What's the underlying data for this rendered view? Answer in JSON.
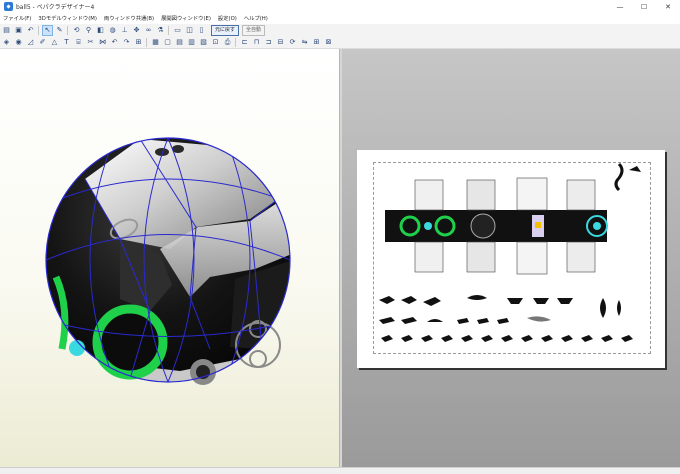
{
  "window": {
    "title": "ball5 - ペパクラデザイナー4",
    "controls": {
      "minimize": "—",
      "maximize": "☐",
      "close": "✕"
    }
  },
  "menu": {
    "items": [
      {
        "label": "ファイル(F)"
      },
      {
        "label": "3Dモデルウィンドウ(M)"
      },
      {
        "label": "両ウィンドウ共通(B)"
      },
      {
        "label": "展開図ウィンドウ(E)"
      },
      {
        "label": "設定(O)"
      },
      {
        "label": "ヘルプ(H)"
      }
    ]
  },
  "toolbar": {
    "reset_label": "元に戻す",
    "auto_label": "全自動"
  },
  "icons": {
    "app": "app-icon",
    "open": "folder-open-icon",
    "save": "save-icon",
    "select": "cursor-icon",
    "edit": "pen-icon",
    "rotate": "rotate-icon",
    "zoom": "magnifier-icon",
    "layout": "layout-icon",
    "text": "text-icon",
    "print": "printer-icon"
  },
  "colors": {
    "accent_green": "#1fd14a",
    "accent_cyan": "#3ad9df",
    "mesh_edge": "#2a2acf",
    "model_body": "#141414"
  }
}
